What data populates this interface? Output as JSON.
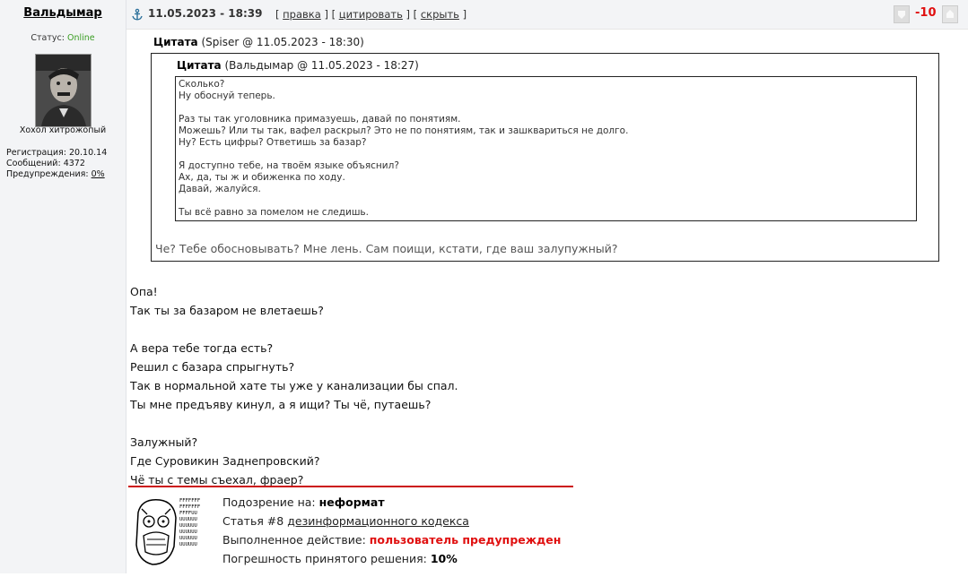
{
  "user": {
    "name": "Вальдымар",
    "status_label": "Статус:",
    "status_value": "Online",
    "title": "Хохол хитрожопый",
    "stats": {
      "registration_label": "Регистрация:",
      "registration_value": "20.10.14",
      "messages_label": "Сообщений:",
      "messages_value": "4372",
      "warnings_label": "Предупреждения:",
      "warnings_value": "0%"
    }
  },
  "post": {
    "date": "11.05.2023 - 18:39",
    "links": {
      "edit": "правка",
      "quote": "цитировать",
      "hide": "скрыть"
    },
    "rating": "-10",
    "outer_quote": {
      "label": "Цитата",
      "meta": "(Spiser @ 11.05.2023 - 18:30)",
      "inner_quote": {
        "label": "Цитата",
        "meta": "(Вальдымар @ 11.05.2023 - 18:27)",
        "text": "Сколько?\nНу обоснуй теперь.\n\nРаз ты так уголовника примазуешь, давай по понятиям.\nМожешь? Или ты так, вафел раскрыл? Это не по понятиям, так и зашквариться не долго.\nНу? Есть цифры? Ответишь за базар?\n\nЯ доступно тебе, на твоём языке объяснил?\nАх, да, ты ж и обиженка по ходу.\nДавай, жалуйся.\n\nТы всё равно за помелом не следишь."
      },
      "reply": "Че? Тебе обосновывать? Мне лень. Сам поищи, кстати, где ваш залупужный?"
    },
    "body": "Опа!\nТак ты за базаром не влетаешь?\n\nА вера тебе тогда есть?\nРешил с базара спрыгнуть?\nТак в нормальной хате ты уже у канализации бы спал.\nТы мне предъяву кинул, а я ищи? Ты чё, путаешь?\n\nЗалужный?\nГде Суровикин Заднепровский?\nЧё ты с темы съехал, фраер?"
  },
  "moderation": {
    "suspicion_label": "Подозрение на:",
    "suspicion_value": "неформат",
    "article_prefix": "Статья #8",
    "article_link": "дезинформационного кодекса",
    "action_label": "Выполненное действие:",
    "action_value": "пользователь предупрежден",
    "error_label": "Погрешность принятого решения:",
    "error_value": "10%",
    "rage_text": "FFFFFFFFFFUUUUUUUU"
  },
  "colors": {
    "rating": "#e01010",
    "online": "#3a9d23",
    "action": "#e01010",
    "rule": "#cc1111"
  }
}
